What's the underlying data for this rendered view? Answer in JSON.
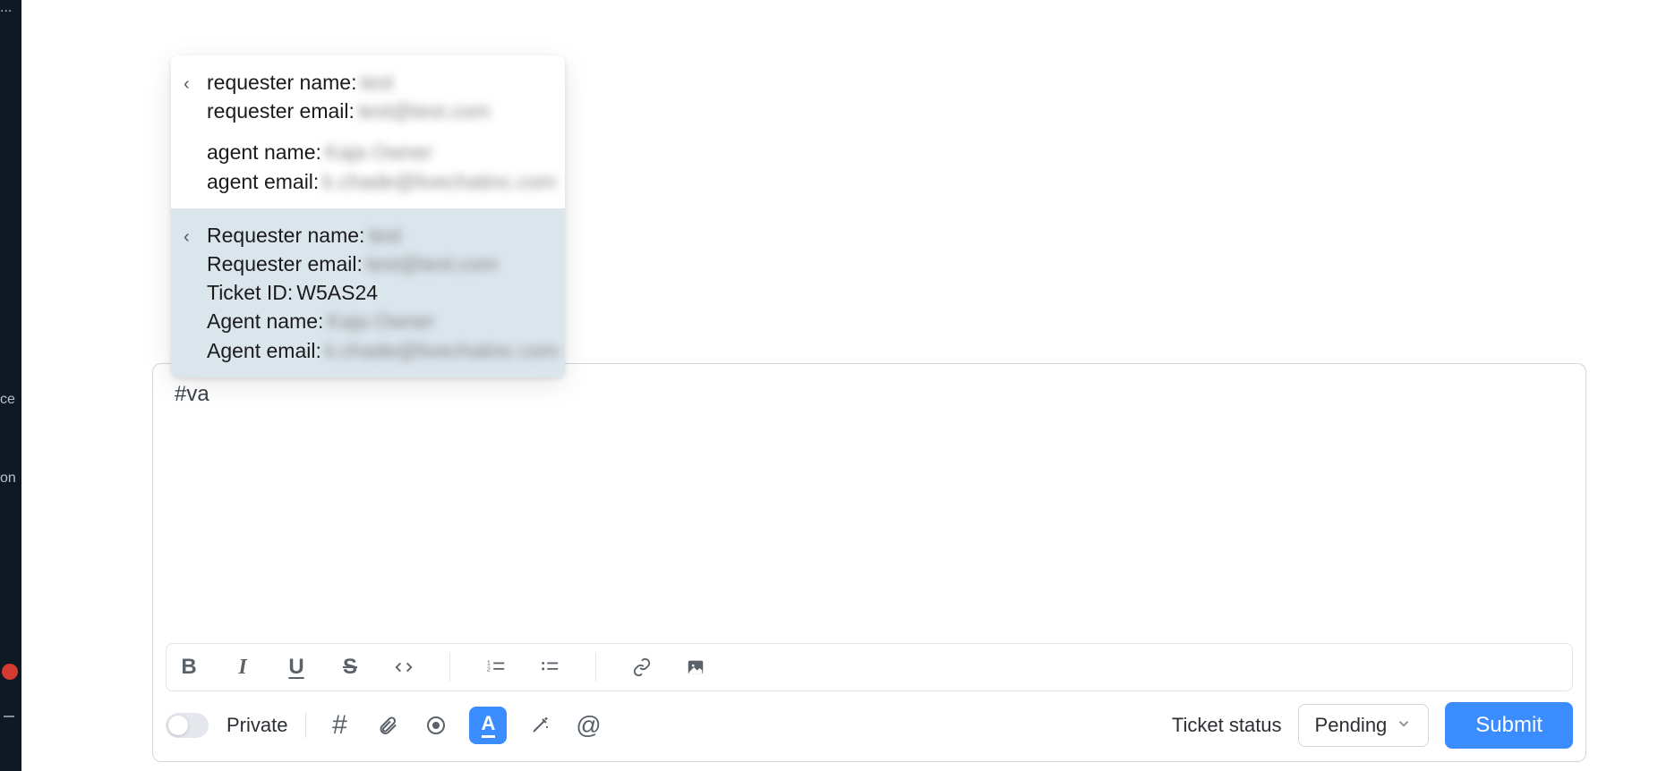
{
  "sidebar": {
    "top_items": [
      {
        "text": "..."
      },
      {
        "text": "ce"
      },
      {
        "text": "on"
      }
    ]
  },
  "autocomplete": {
    "items": [
      {
        "rows": [
          {
            "label": "requester name:",
            "value": "test",
            "blur": true
          },
          {
            "label": "requester email:",
            "value": "test@test.com",
            "blur": true
          },
          {
            "spacer": true
          },
          {
            "label": "agent name:",
            "value": "Kaja Owner",
            "blur": true
          },
          {
            "label": "agent email:",
            "value": "k.chade@livechatinc.com",
            "blur": true
          }
        ],
        "hover": false
      },
      {
        "rows": [
          {
            "label": "Requester name:",
            "value": "test",
            "blur": true
          },
          {
            "label": "Requester email:",
            "value": "test@test.com",
            "blur": true
          },
          {
            "label": "Ticket ID:",
            "value": "W5AS24",
            "blur": false
          },
          {
            "label": "Agent name:",
            "value": "Kaja Owner",
            "blur": true
          },
          {
            "label": "Agent email:",
            "value": "k.chade@livechatinc.com",
            "blur": true
          }
        ],
        "hover": true
      }
    ]
  },
  "compose": {
    "text": "#va"
  },
  "format_toolbar": {
    "bold": "B",
    "italic": "I",
    "underline": "U",
    "strike": "S"
  },
  "bottom_bar": {
    "private_label": "Private",
    "status_label": "Ticket status",
    "status_value": "Pending",
    "submit_label": "Submit"
  },
  "colors": {
    "accent": "#3b8cff",
    "sidebar_bg": "#0f1923"
  }
}
